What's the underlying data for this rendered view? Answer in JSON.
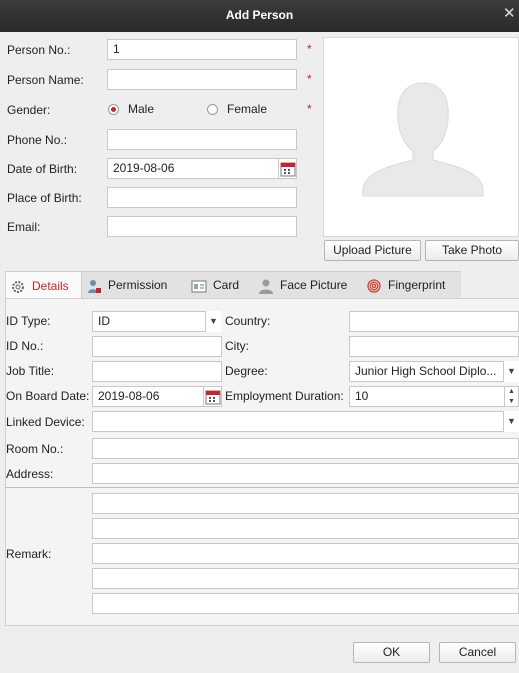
{
  "window": {
    "title": "Add Person",
    "close_glyph": "✕"
  },
  "person": {
    "person_no_label": "Person No.:",
    "person_no_value": "1",
    "person_name_label": "Person Name:",
    "person_name_value": "",
    "gender_label": "Gender:",
    "gender_male": "Male",
    "gender_female": "Female",
    "gender_selected": "Male",
    "phone_label": "Phone No.:",
    "phone_value": "",
    "dob_label": "Date of Birth:",
    "dob_value": "2019-08-06",
    "pob_label": "Place of Birth:",
    "pob_value": "",
    "email_label": "Email:",
    "email_value": "",
    "required_mark": "*"
  },
  "photo": {
    "upload_label": "Upload Picture",
    "take_label": "Take Photo"
  },
  "tabs": [
    {
      "label": "Details",
      "icon": "gear-icon",
      "active": true
    },
    {
      "label": "Permission",
      "icon": "user-lock-icon",
      "active": false
    },
    {
      "label": "Card",
      "icon": "card-icon",
      "active": false
    },
    {
      "label": "Face Picture",
      "icon": "face-icon",
      "active": false
    },
    {
      "label": "Fingerprint",
      "icon": "fingerprint-icon",
      "active": false
    }
  ],
  "details": {
    "id_type_label": "ID Type:",
    "id_type_value": "ID",
    "country_label": "Country:",
    "country_value": "",
    "id_no_label": "ID No.:",
    "id_no_value": "",
    "city_label": "City:",
    "city_value": "",
    "job_title_label": "Job Title:",
    "job_title_value": "",
    "degree_label": "Degree:",
    "degree_value": "Junior High School Diplo...",
    "on_board_label": "On Board Date:",
    "on_board_value": "2019-08-06",
    "employment_label": "Employment Duration:",
    "employment_value": "10",
    "linked_device_label": "Linked Device:",
    "linked_device_value": "",
    "room_label": "Room No.:",
    "room_value": "",
    "address_label": "Address:",
    "address_value": "",
    "remark_label": "Remark:"
  },
  "footer": {
    "ok_label": "OK",
    "cancel_label": "Cancel"
  },
  "colors": {
    "accent_red": "#d0202a",
    "titlebar": "#333333"
  }
}
